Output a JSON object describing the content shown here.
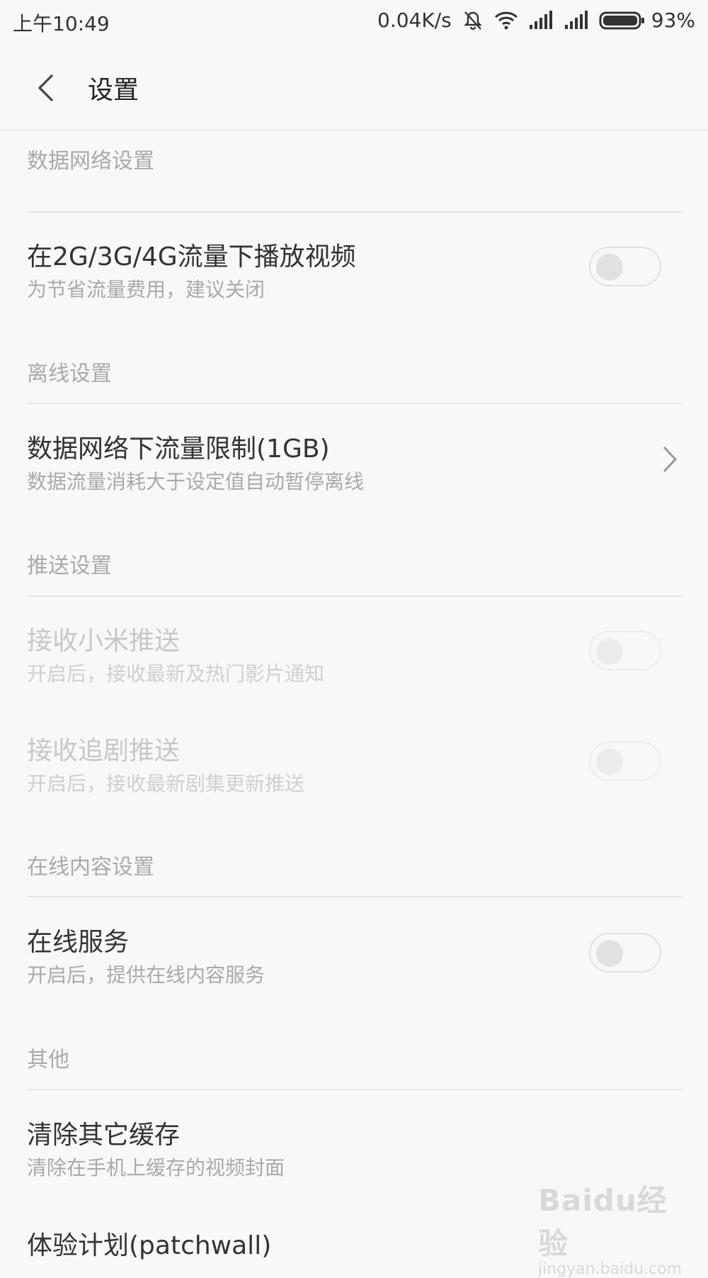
{
  "status_bar": {
    "time": "上午10:49",
    "net_speed": "0.04K/s",
    "battery": "93%",
    "icons": [
      "bell-off-icon",
      "wifi-icon",
      "signal-icon",
      "signal-icon-2",
      "battery-icon"
    ]
  },
  "header": {
    "title": "设置"
  },
  "sections": {
    "data_network": {
      "title": "数据网络设置",
      "play_video": {
        "title": "在2G/3G/4G流量下播放视频",
        "subtitle": "为节省流量费用，建议关闭",
        "on": false
      }
    },
    "offline": {
      "title": "离线设置",
      "limit": {
        "title": "数据网络下流量限制(1GB)",
        "subtitle": "数据流量消耗大于设定值自动暂停离线"
      }
    },
    "push": {
      "title": "推送设置",
      "xiaomi_push": {
        "title": "接收小米推送",
        "subtitle": "开启后，接收最新及热门影片通知",
        "on": false,
        "enabled": false
      },
      "follow_push": {
        "title": "接收追剧推送",
        "subtitle": "开启后，接收最新剧集更新推送",
        "on": false,
        "enabled": false
      }
    },
    "online": {
      "title": "在线内容设置",
      "service": {
        "title": "在线服务",
        "subtitle": "开启后，提供在线内容服务",
        "on": false
      }
    },
    "other": {
      "title": "其他",
      "clear_cache": {
        "title": "清除其它缓存",
        "subtitle": "清除在手机上缓存的视频封面"
      },
      "patchwall": {
        "title": "体验计划(patchwall)"
      }
    }
  },
  "watermark": {
    "logo": "Baidu经验",
    "url": "jingyan.baidu.com"
  }
}
